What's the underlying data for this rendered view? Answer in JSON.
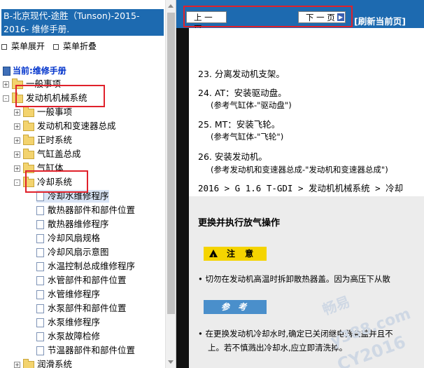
{
  "left_panel": {
    "title": "B-北京现代-途胜（Tunson)-2015-2016- 维修手册.",
    "menu_expand": "菜单展开",
    "menu_collapse": "菜单折叠",
    "tree_root": "当前:维修手册",
    "tree": [
      {
        "label": "一般事项",
        "expander": "+"
      },
      {
        "label": "发动机机械系统",
        "expander": "-"
      },
      {
        "label": "一般事项",
        "expander": "+"
      },
      {
        "label": "发动机和变速器总成",
        "expander": "+"
      },
      {
        "label": "正时系统",
        "expander": "+"
      },
      {
        "label": "气缸盖总成",
        "expander": "+"
      },
      {
        "label": "气缸体",
        "expander": "+"
      },
      {
        "label": "冷却系统",
        "expander": "-"
      },
      {
        "label": "冷却水维修程序"
      },
      {
        "label": "散热器部件和部件位置"
      },
      {
        "label": "散热器维修程序"
      },
      {
        "label": "冷却风扇规格"
      },
      {
        "label": "冷却风扇示意图"
      },
      {
        "label": "水温控制总成维修程序"
      },
      {
        "label": "水管部件和部件位置"
      },
      {
        "label": "水管维修程序"
      },
      {
        "label": "水泵部件和部件位置"
      },
      {
        "label": "水泵维修程序"
      },
      {
        "label": "水泵故障检修"
      },
      {
        "label": "节温器部件和部件位置"
      },
      {
        "label": "润滑系统",
        "expander": "+"
      }
    ]
  },
  "toolbar": {
    "prev_label": "上 一 页",
    "next_label": "下 一 页",
    "refresh_label": "[刷新当前页]"
  },
  "content": {
    "steps": [
      {
        "text": "23. 分离发动机支架。"
      },
      {
        "text": "24. AT：安装驱动盘。",
        "sub": "(参考气缸体-\"驱动盘\")"
      },
      {
        "text": "25. MT：安装飞轮。",
        "sub": "(参考气缸体-\"飞轮\")"
      },
      {
        "text": "26. 安装发动机。",
        "sub": "(参考发动机和变速器总成-\"发动机和变速器总成\")"
      }
    ],
    "breadcrumb": "2016 > G 1.6 T-GDI > 发动机机械系统 > 冷却",
    "section_title": "更换并执行放气操作",
    "caution_label": "注 意",
    "caution_text": "• 切勿在发动机高温时拆卸散热器盖。因为高压下从散",
    "reference_label": "参 考",
    "reference_text_1": "• 在更换发动机冷却水时,确定已关闭继电器盒盖并且不",
    "reference_text_2": "上。若不慎溅出冷却水,应立即清洗掉。",
    "watermark_1": "畅易",
    "watermark_2": "y388.com",
    "watermark_3": "CY2016"
  },
  "colors": {
    "header_blue": "#1d6ab0",
    "highlight_red": "#e0212b",
    "caution_yellow": "#f5d400",
    "reference_blue": "#4a8fcb"
  }
}
